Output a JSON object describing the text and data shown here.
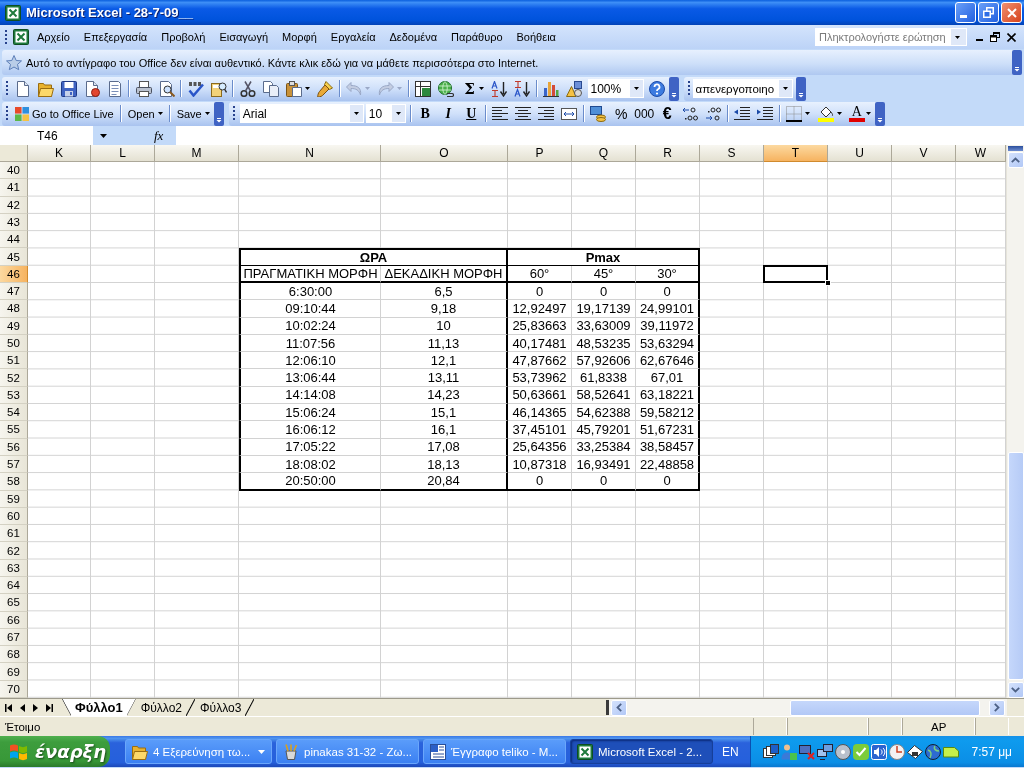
{
  "window": {
    "title": "Microsoft Excel - 28-7-09__"
  },
  "menu_bar": {
    "items": [
      "Αρχείο",
      "Επεξεργασία",
      "Προβολή",
      "Εισαγωγή",
      "Μορφή",
      "Εργαλεία",
      "Δεδομένα",
      "Παράθυρο",
      "Βοήθεια"
    ],
    "help_box": {
      "placeholder": "Πληκτρολογήστε ερώτηση"
    }
  },
  "info_bar": {
    "text": "Αυτό το αντίγραφο του Office δεν είναι αυθεντικό. Κάντε κλικ εδώ για να μάθετε περισσότερα στο Internet."
  },
  "standard_toolbar": {
    "undo": {
      "disabled": true
    },
    "redo": {
      "disabled": true
    },
    "autosum": "Σ",
    "zoom": {
      "value": "100%"
    }
  },
  "style_toolbar": {
    "value": "απενεργοποιηο"
  },
  "office_live_toolbar": {
    "buttons": [
      {
        "label": "Go to Office Live",
        "kind": "link"
      },
      {
        "label": "Open",
        "kind": "menu"
      },
      {
        "label": "Save",
        "kind": "menu"
      }
    ]
  },
  "formatting_toolbar": {
    "font": {
      "value": "Arial"
    },
    "size": {
      "value": "10"
    },
    "bold": "B",
    "italic": "I",
    "underline": "U",
    "percent": "%",
    "thousands": "000",
    "euro": "€",
    "font_color": "A"
  },
  "formula_bar": {
    "name_box": "T46",
    "function_label": "fx"
  },
  "sheet": {
    "columns": [
      {
        "label": "K",
        "selected": false
      },
      {
        "label": "L",
        "selected": false
      },
      {
        "label": "M",
        "selected": false
      },
      {
        "label": "N",
        "selected": false
      },
      {
        "label": "O",
        "selected": false
      },
      {
        "label": "P",
        "selected": false
      },
      {
        "label": "Q",
        "selected": false
      },
      {
        "label": "R",
        "selected": false
      },
      {
        "label": "S",
        "selected": false
      },
      {
        "label": "T",
        "selected": true
      },
      {
        "label": "U",
        "selected": false
      },
      {
        "label": "V",
        "selected": false
      },
      {
        "label": "W",
        "selected": false
      }
    ],
    "rows": [
      {
        "label": "40",
        "selected": false
      },
      {
        "label": "41",
        "selected": false
      },
      {
        "label": "42",
        "selected": false
      },
      {
        "label": "43",
        "selected": false
      },
      {
        "label": "44",
        "selected": false
      },
      {
        "label": "45",
        "selected": false
      },
      {
        "label": "46",
        "selected": true
      },
      {
        "label": "47",
        "selected": false
      },
      {
        "label": "48",
        "selected": false
      },
      {
        "label": "49",
        "selected": false
      },
      {
        "label": "50",
        "selected": false
      },
      {
        "label": "51",
        "selected": false
      },
      {
        "label": "52",
        "selected": false
      },
      {
        "label": "53",
        "selected": false
      },
      {
        "label": "54",
        "selected": false
      },
      {
        "label": "55",
        "selected": false
      },
      {
        "label": "56",
        "selected": false
      },
      {
        "label": "57",
        "selected": false
      },
      {
        "label": "58",
        "selected": false
      },
      {
        "label": "59",
        "selected": false
      },
      {
        "label": "60",
        "selected": false
      },
      {
        "label": "61",
        "selected": false
      },
      {
        "label": "62",
        "selected": false
      },
      {
        "label": "63",
        "selected": false
      },
      {
        "label": "64",
        "selected": false
      },
      {
        "label": "65",
        "selected": false
      },
      {
        "label": "66",
        "selected": false
      },
      {
        "label": "67",
        "selected": false
      },
      {
        "label": "68",
        "selected": false
      },
      {
        "label": "69",
        "selected": false
      },
      {
        "label": "70",
        "selected": false
      }
    ],
    "table": {
      "groups": [
        {
          "label": "ΩΡΑ",
          "columns": [
            "ΠΡΑΓΜΑΤΙΚΗ ΜΟΡΦΗ",
            "ΔΕΚΑΔΙΚΗ ΜΟΡΦΗ"
          ]
        },
        {
          "label": "Pmax",
          "columns": [
            "60°",
            "45°",
            "30°"
          ]
        }
      ],
      "rows": [
        [
          "6:30:00",
          "6,5",
          "0",
          "0",
          "0"
        ],
        [
          "09:10:44",
          "9,18",
          "12,92497",
          "19,17139",
          "24,99101"
        ],
        [
          "10:02:24",
          "10",
          "25,83663",
          "33,63009",
          "39,11972"
        ],
        [
          "11:07:56",
          "11,13",
          "40,17481",
          "48,53235",
          "53,63294"
        ],
        [
          "12:06:10",
          "12,1",
          "47,87662",
          "57,92606",
          "62,67646"
        ],
        [
          "13:06:44",
          "13,11",
          "53,73962",
          "61,8338",
          "67,01"
        ],
        [
          "14:14:08",
          "14,23",
          "50,63661",
          "58,52641",
          "63,18221"
        ],
        [
          "15:06:24",
          "15,1",
          "46,14365",
          "54,62388",
          "59,58212"
        ],
        [
          "16:06:12",
          "16,1",
          "37,45101",
          "45,79201",
          "51,67231"
        ],
        [
          "17:05:22",
          "17,08",
          "25,64356",
          "33,25384",
          "38,58457"
        ],
        [
          "18:08:02",
          "18,13",
          "10,87318",
          "16,93491",
          "22,48858"
        ],
        [
          "20:50:00",
          "20,84",
          "0",
          "0",
          "0"
        ]
      ]
    }
  },
  "sheet_tabs": [
    {
      "label": "Φύλλο1",
      "selected": true
    },
    {
      "label": "Φύλλο2",
      "selected": false
    },
    {
      "label": "Φύλλο3",
      "selected": false
    }
  ],
  "status_bar": {
    "message": "Έτοιμο",
    "indicator": "AP"
  },
  "taskbar": {
    "start": "έναρξη",
    "buttons": [
      {
        "label": "4 Εξερεύνηση τω...",
        "kind": "group",
        "selected": false
      },
      {
        "label": "pinakas 31-32 - Ζω...",
        "kind": "window",
        "selected": false
      },
      {
        "label": "Έγγραφο teliko - M...",
        "kind": "window",
        "selected": false
      },
      {
        "label": "Microsoft Excel - 2...",
        "kind": "window",
        "selected": true
      }
    ],
    "language": "EN",
    "clock": "7:57 μμ"
  }
}
